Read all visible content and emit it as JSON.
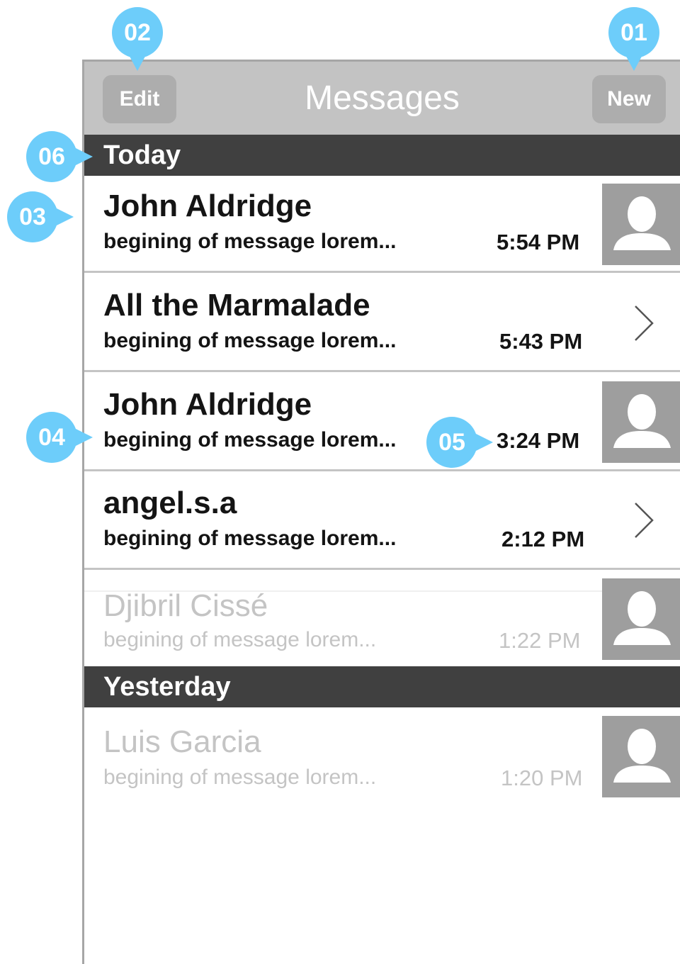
{
  "header": {
    "title": "Messages",
    "edit_label": "Edit",
    "new_label": "New"
  },
  "sections": [
    {
      "label": "Today"
    },
    {
      "label": "Yesterday"
    }
  ],
  "messages": [
    {
      "name": "John Aldridge",
      "preview": "begining of message lorem...",
      "time": "5:54 PM",
      "accessory": "avatar",
      "state": "normal"
    },
    {
      "name": "All the Marmalade",
      "preview": "begining of message lorem...",
      "time": "5:43 PM",
      "accessory": "chevron-right-icon",
      "state": "normal"
    },
    {
      "name": "John Aldridge",
      "preview": "begining of message lorem...",
      "time": "3:24 PM",
      "accessory": "avatar",
      "state": "normal"
    },
    {
      "name": "angel.s.a",
      "preview": "begining of message lorem...",
      "time": "2:12 PM",
      "accessory": "chevron-right-icon",
      "state": "normal"
    },
    {
      "name": "Djibril Cissé",
      "preview": "begining of message lorem...",
      "time": "1:22 PM",
      "accessory": "avatar",
      "state": "faded"
    },
    {
      "name": "Luis Garcia",
      "preview": "begining of message lorem...",
      "time": "1:20 PM",
      "accessory": "avatar",
      "state": "faded"
    }
  ],
  "annotations": [
    "01",
    "02",
    "03",
    "04",
    "05",
    "06"
  ],
  "colors": {
    "navbar": "#c3c3c3",
    "nav_button": "#adadad",
    "section_header": "#404040",
    "avatar": "#9e9e9e",
    "annotation": "#6dcdfa",
    "faded_text": "#c4c4c4"
  }
}
